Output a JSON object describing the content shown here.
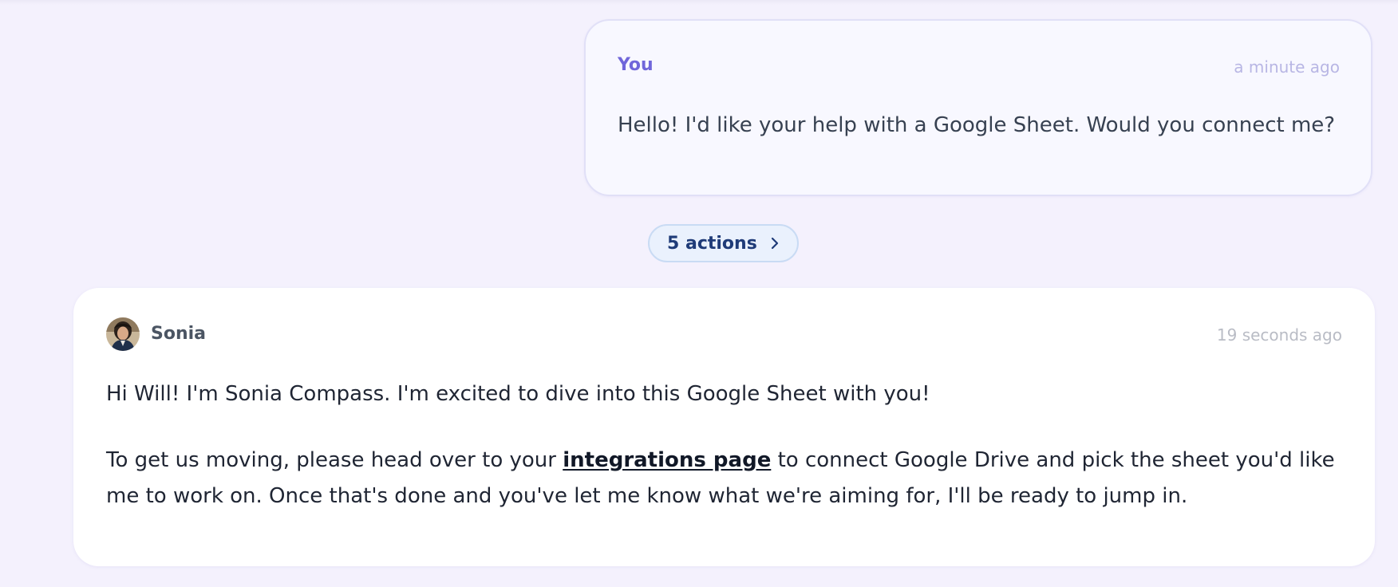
{
  "conversation": {
    "user_message": {
      "sender": "You",
      "timestamp": "a minute ago",
      "text": "Hello! I'd like your help with a Google Sheet. Would you connect me?"
    },
    "actions": {
      "label": "5 actions",
      "icon": "chevron-right-icon"
    },
    "assistant_message": {
      "sender": "Sonia",
      "avatar": "avatar-photo",
      "timestamp": "19 seconds ago",
      "paragraph1": "Hi Will! I'm Sonia Compass. I'm excited to dive into this Google Sheet with you!",
      "paragraph2": {
        "before_link": "To get us moving, please head over to your ",
        "link_text": "integrations page",
        "after_link": " to connect Google Drive and pick the sheet you'd like me to work on. Once that's done and you've let me know what we're aiming for, I'll be ready to jump in."
      }
    }
  },
  "colors": {
    "background": "#f4f1fd",
    "user_name": "#7066da",
    "actions_text": "#1f3b78",
    "link": "#111827"
  }
}
